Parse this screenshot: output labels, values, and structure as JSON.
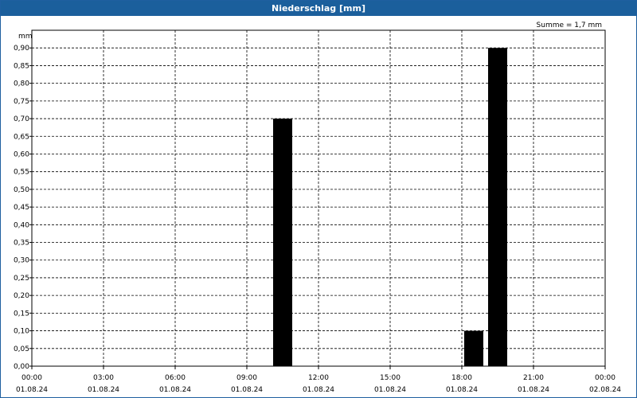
{
  "window": {
    "title": "Niederschlag [mm]"
  },
  "chart_data": {
    "type": "bar",
    "title": "Niederschlag [mm]",
    "ylabel": "mm",
    "annotation": "Summe = 1,7 mm",
    "ylim": [
      0,
      0.95
    ],
    "y_ticks": [
      "0,00",
      "0,05",
      "0,10",
      "0,15",
      "0,20",
      "0,25",
      "0,30",
      "0,35",
      "0,40",
      "0,45",
      "0,50",
      "0,55",
      "0,60",
      "0,65",
      "0,70",
      "0,75",
      "0,80",
      "0,85",
      "0,90"
    ],
    "x_range_hours": [
      0,
      24
    ],
    "x_ticks": [
      {
        "time": "00:00",
        "date": "01.08.24"
      },
      {
        "time": "03:00",
        "date": "01.08.24"
      },
      {
        "time": "06:00",
        "date": "01.08.24"
      },
      {
        "time": "09:00",
        "date": "01.08.24"
      },
      {
        "time": "12:00",
        "date": "01.08.24"
      },
      {
        "time": "15:00",
        "date": "01.08.24"
      },
      {
        "time": "18:00",
        "date": "01.08.24"
      },
      {
        "time": "21:00",
        "date": "01.08.24"
      },
      {
        "time": "00:00",
        "date": "02.08.24"
      }
    ],
    "bars": [
      {
        "start": "10:00",
        "end": "11:00",
        "value": 0.7
      },
      {
        "start": "18:00",
        "end": "19:00",
        "value": 0.1
      },
      {
        "start": "19:00",
        "end": "20:00",
        "value": 0.9
      }
    ],
    "bar_color": "#000000",
    "grid": true
  }
}
